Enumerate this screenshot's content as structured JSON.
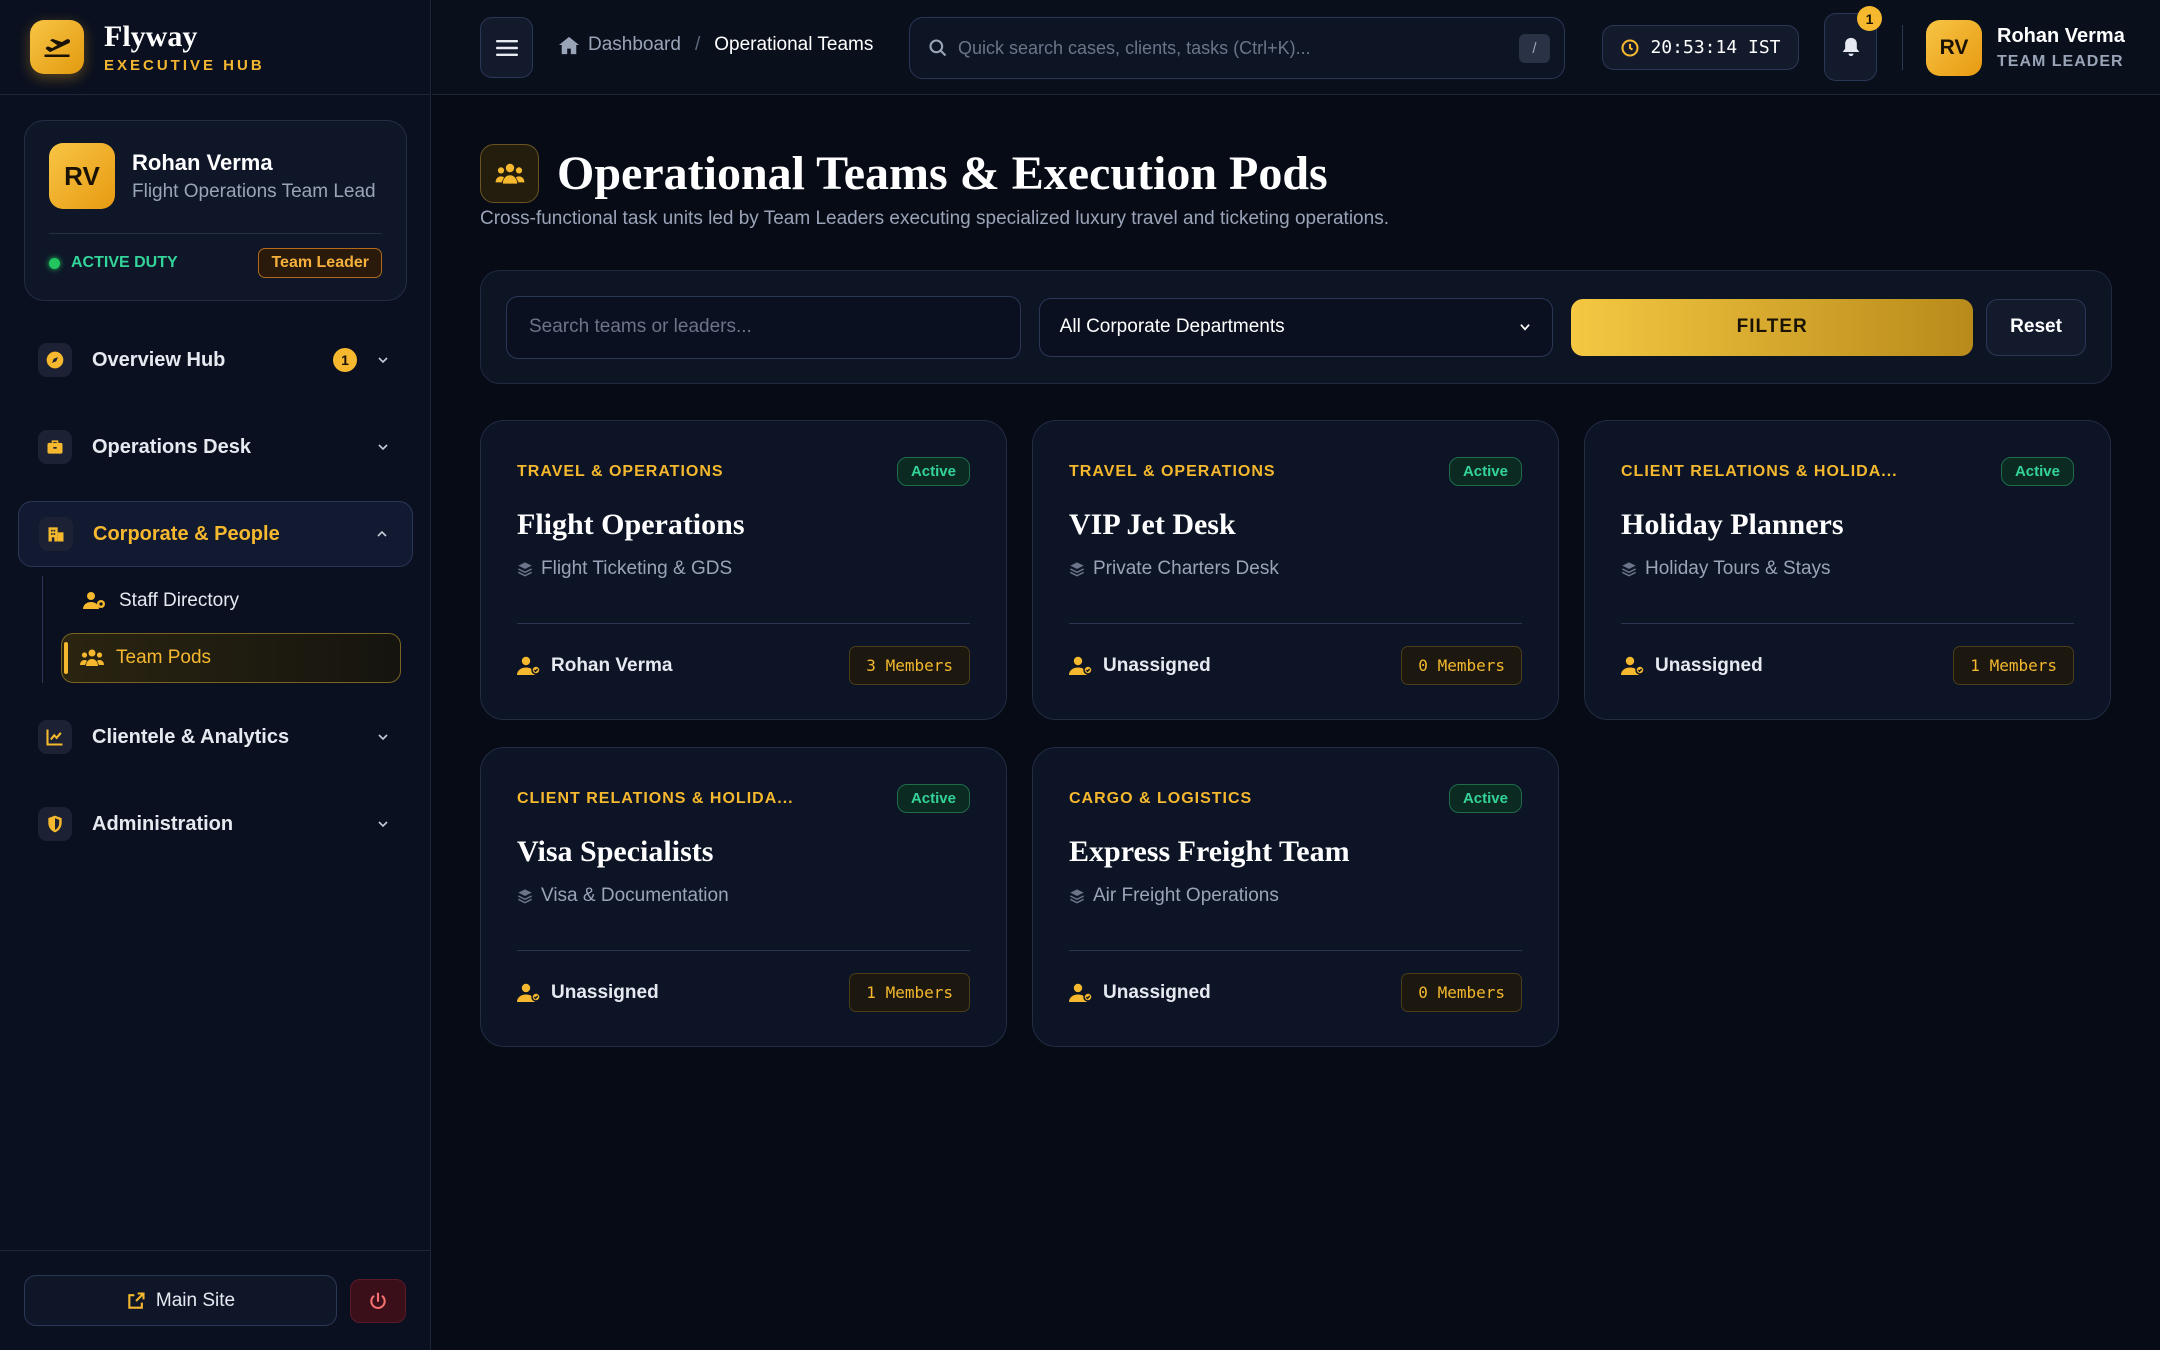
{
  "brand": {
    "name": "Flyway",
    "subtitle": "EXECUTIVE HUB"
  },
  "profile": {
    "initials": "RV",
    "name": "Rohan Verma",
    "role": "Flight Operations Team Lead",
    "duty_status": "ACTIVE DUTY",
    "badge": "Team Leader"
  },
  "nav": {
    "overview": {
      "label": "Overview Hub",
      "count": "1"
    },
    "operations": {
      "label": "Operations Desk"
    },
    "corporate": {
      "label": "Corporate & People"
    },
    "staff_directory": {
      "label": "Staff Directory"
    },
    "team_pods": {
      "label": "Team Pods"
    },
    "clientele": {
      "label": "Clientele & Analytics"
    },
    "administration": {
      "label": "Administration"
    }
  },
  "footer": {
    "main_site": "Main Site"
  },
  "header": {
    "breadcrumb_home": "Dashboard",
    "breadcrumb_sep": "/",
    "breadcrumb_current": "Operational Teams",
    "search_placeholder": "Quick search cases, clients, tasks (Ctrl+K)...",
    "search_kbd": "/",
    "clock": "20:53:14 IST",
    "notifications": "1",
    "user_initials": "RV",
    "user_name": "Rohan Verma",
    "user_role": "TEAM LEADER"
  },
  "page": {
    "title": "Operational Teams & Execution Pods",
    "subtitle": "Cross-functional task units led by Team Leaders executing specialized luxury travel and ticketing operations."
  },
  "filters": {
    "search_placeholder": "Search teams or leaders...",
    "department_selected": "All Corporate Departments",
    "filter_label": "FILTER",
    "reset_label": "Reset"
  },
  "teams": [
    {
      "department": "TRAVEL & OPERATIONS",
      "status": "Active",
      "name": "Flight Operations",
      "desk": "Flight Ticketing & GDS",
      "leader": "Rohan Verma",
      "members": "3 Members"
    },
    {
      "department": "TRAVEL & OPERATIONS",
      "status": "Active",
      "name": "VIP Jet Desk",
      "desk": "Private Charters Desk",
      "leader": "Unassigned",
      "members": "0 Members"
    },
    {
      "department": "CLIENT RELATIONS & HOLIDA...",
      "status": "Active",
      "name": "Holiday Planners",
      "desk": "Holiday Tours & Stays",
      "leader": "Unassigned",
      "members": "1 Members"
    },
    {
      "department": "CLIENT RELATIONS & HOLIDA...",
      "status": "Active",
      "name": "Visa Specialists",
      "desk": "Visa & Documentation",
      "leader": "Unassigned",
      "members": "1 Members"
    },
    {
      "department": "CARGO & LOGISTICS",
      "status": "Active",
      "name": "Express Freight Team",
      "desk": "Air Freight Operations",
      "leader": "Unassigned",
      "members": "0 Members"
    }
  ],
  "colors": {
    "accent": "#f5b82e",
    "background": "#070b16",
    "active_status": "#34d399"
  }
}
